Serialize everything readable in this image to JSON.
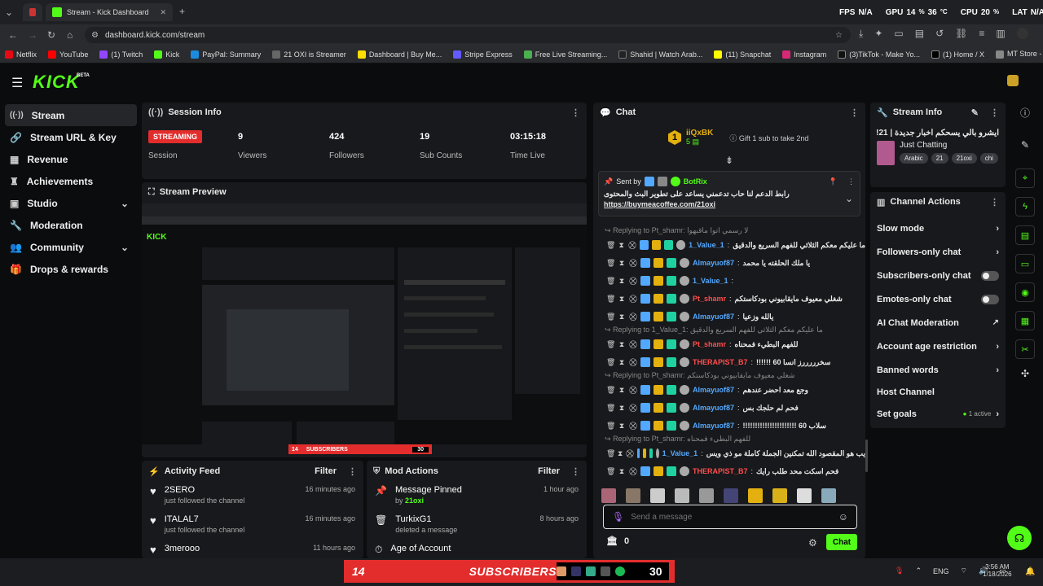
{
  "browser": {
    "tab_title": "Stream - Kick Dashboard",
    "url": "dashboard.kick.com/stream",
    "overlay": {
      "fps_label": "FPS",
      "fps_value": "N/A",
      "gpu_label": "GPU",
      "gpu_value": "14",
      "gpu_temp": "36",
      "cpu_label": "CPU",
      "cpu_value": "20",
      "lat_label": "LAT",
      "lat_value": "N/A"
    },
    "bookmarks": [
      "Netflix",
      "YouTube",
      "(1) Twitch",
      "Kick",
      "PayPal: Summary",
      "21 OXI is Streamer",
      "Dashboard | Buy Me...",
      "Stripe Express",
      "Free Live Streaming...",
      "Shahid | Watch Arab...",
      "(11) Snapchat",
      "Instagram",
      "(3)TikTok - Make Yo...",
      "(1) Home / X",
      "MT Store - مرحبا"
    ]
  },
  "brand": {
    "logo": "KICK",
    "beta": "BETA",
    "accent": "#53fc18"
  },
  "sidebar": {
    "items": [
      {
        "label": "Stream",
        "icon": "broadcast-icon"
      },
      {
        "label": "Stream URL & Key",
        "icon": "link-icon"
      },
      {
        "label": "Revenue",
        "icon": "revenue-icon"
      },
      {
        "label": "Achievements",
        "icon": "trophy-icon"
      },
      {
        "label": "Studio",
        "icon": "studio-icon"
      },
      {
        "label": "Moderation",
        "icon": "wrench-icon"
      },
      {
        "label": "Community",
        "icon": "people-icon"
      },
      {
        "label": "Drops & rewards",
        "icon": "gift-icon"
      }
    ]
  },
  "session": {
    "title": "Session Info",
    "status": "STREAMING",
    "status_label": "Session",
    "stats": [
      {
        "value": "9",
        "label": "Viewers"
      },
      {
        "value": "424",
        "label": "Followers"
      },
      {
        "value": "19",
        "label": "Sub Counts"
      },
      {
        "value": "03:15:18",
        "label": "Time Live"
      }
    ]
  },
  "preview": {
    "title": "Stream Preview"
  },
  "overlay_bar": {
    "left": "14",
    "text": "SUBSCRIBERS",
    "right": "30"
  },
  "activity": {
    "title": "Activity Feed",
    "filter": "Filter",
    "items": [
      {
        "name": "2SERO",
        "action": "just followed the channel",
        "time": "16 minutes ago"
      },
      {
        "name": "ITALAL7",
        "action": "just followed the channel",
        "time": "16 minutes ago"
      },
      {
        "name": "3merooo",
        "action": "",
        "time": "11 hours ago"
      }
    ]
  },
  "mod": {
    "title": "Mod Actions",
    "filter": "Filter",
    "items": [
      {
        "name": "Message Pinned",
        "by": "by",
        "user": "21oxi",
        "time": "1 hour ago"
      },
      {
        "name": "TurkixG1",
        "action": "deleted a message",
        "time": "8 hours ago"
      },
      {
        "name": "Age of Account",
        "time": ""
      }
    ]
  },
  "chat": {
    "title": "Chat",
    "gift_user": "iiQxBK",
    "gift_count": "5",
    "gift_text": "Gift 1 sub to take 2nd",
    "gift_rank": "1",
    "pinned": {
      "sent_by": "Sent by",
      "user": "BotRix",
      "text": "رابط الدعم لنا حاب تدعمني يساعد على تطوير البث والمحتوى",
      "link": "https://buymeacoffee.com/21oxi"
    },
    "messages": [
      {
        "reply": "Replying to Pt_shamr: لا رسمي اتوا ماقبهوا",
        "user": "1_Value_1",
        "color": "#53a8ff",
        "text": "ما عليكم معكم الثلاثي للفهم السريع والدقيق"
      },
      {
        "reply": "",
        "user": "Almayuof87",
        "color": "#53a8ff",
        "text": "يا ملك الحلقته يا محمد"
      },
      {
        "reply": "",
        "user": "1_Value_1",
        "color": "#53a8ff",
        "text": ""
      },
      {
        "reply": "",
        "user": "Pt_shamr",
        "color": "#ff4d4d",
        "text": "شغلي معيوف مايقابيوني بودكاستكم"
      },
      {
        "reply": "",
        "user": "Almayuof87",
        "color": "#53a8ff",
        "text": "يالله وزعيا"
      },
      {
        "reply": "Replying to 1_Value_1: ما عليكم معكم الثلاثي للفهم السريع والدقيق",
        "user": "Pt_shamr",
        "color": "#ff4d4d",
        "text": "للفهم البطيء فمحناه"
      },
      {
        "reply": "",
        "user": "THERAPIST_B7",
        "color": "#ff4d4d",
        "text": "سخرررررز انسا 60 !!!!!!"
      },
      {
        "reply": "Replying to Pt_shamr: شغلي معيوف مايقابيوني بودكاستكم",
        "user": "Almayuof87",
        "color": "#53a8ff",
        "text": "وجع معد احضر عندهم"
      },
      {
        "reply": "",
        "user": "Almayuof87",
        "color": "#53a8ff",
        "text": "فحم لم حلجك بس"
      },
      {
        "reply": "",
        "user": "Almayuof87",
        "color": "#53a8ff",
        "text": "سلاب 60 !!!!!!!!!!!!!!!!!!!!!!"
      },
      {
        "reply": "Replying to Pt_shamr: للفهم البطيء فمحناه",
        "user": "1_Value_1",
        "color": "#53a8ff",
        "text": "يب هو المقصود الله تمكنين الجملة كاملة مو ذي ويس"
      },
      {
        "reply": "",
        "user": "THERAPIST_B7",
        "color": "#ff4d4d",
        "text": "فحم اسكت محد طلب رايك"
      }
    ],
    "placeholder": "Send a message",
    "points": "0",
    "send": "Chat"
  },
  "stream_info": {
    "title": "Stream Info",
    "stream_title": "ايشرو بالي يسحكم اخبار جديدة | 21!",
    "category": "Just Chatting",
    "tags": [
      "Arabic",
      "21",
      "21oxi",
      "chi"
    ]
  },
  "channel_actions": {
    "title": "Channel Actions",
    "items": [
      {
        "label": "Slow mode",
        "control": "arrow"
      },
      {
        "label": "Followers-only chat",
        "control": "arrow"
      },
      {
        "label": "Subscribers-only chat",
        "control": "toggle"
      },
      {
        "label": "Emotes-only chat",
        "control": "toggle"
      },
      {
        "label": "AI Chat Moderation",
        "control": "external"
      },
      {
        "label": "Account age restriction",
        "control": "arrow"
      },
      {
        "label": "Banned words",
        "control": "arrow"
      },
      {
        "label": "Host Channel",
        "control": "none"
      },
      {
        "label": "Set goals",
        "control": "arrow",
        "status": "1 active"
      }
    ]
  },
  "taskbar": {
    "lang": "ENG",
    "time": "3:56 AM",
    "date": "1/18/2026"
  }
}
